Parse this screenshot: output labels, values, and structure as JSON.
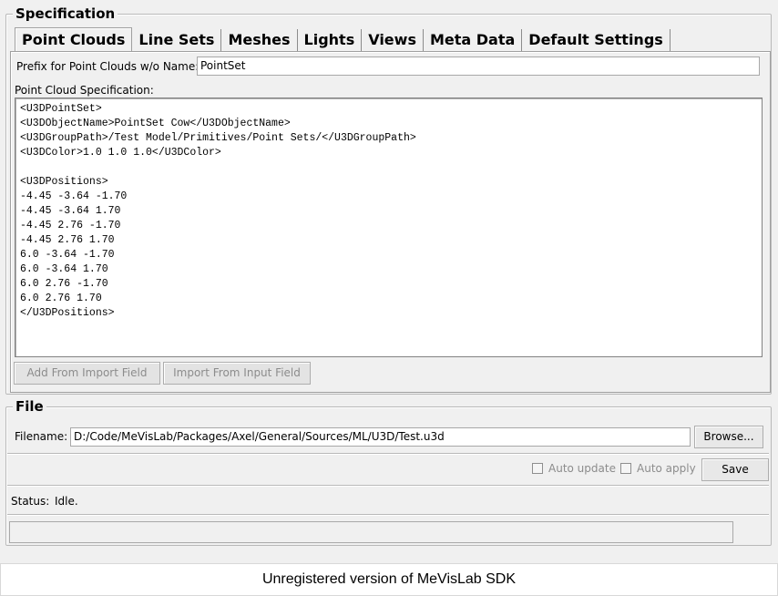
{
  "specification": {
    "title": "Specification",
    "tabs": [
      "Point Clouds",
      "Line Sets",
      "Meshes",
      "Lights",
      "Views",
      "Meta Data",
      "Default Settings"
    ],
    "prefix_label": "Prefix for Point Clouds w/o Name:",
    "prefix_value": "PointSet",
    "spec_label": "Point Cloud Specification:",
    "spec_text": "<U3DPointSet>\n<U3DObjectName>PointSet Cow</U3DObjectName>\n<U3DGroupPath>/Test Model/Primitives/Point Sets/</U3DGroupPath>\n<U3DColor>1.0 1.0 1.0</U3DColor>\n\n<U3DPositions>\n-4.45 -3.64 -1.70\n-4.45 -3.64 1.70\n-4.45 2.76 -1.70\n-4.45 2.76 1.70\n6.0 -3.64 -1.70\n6.0 -3.64 1.70\n6.0 2.76 -1.70\n6.0 2.76 1.70\n</U3DPositions>",
    "add_from_import_label": "Add From Import Field",
    "import_from_input_label": "Import From Input Field"
  },
  "file": {
    "title": "File",
    "filename_label": "Filename:",
    "filename_value": "D:/Code/MeVisLab/Packages/Axel/General/Sources/ML/U3D/Test.u3d",
    "browse_label": "Browse...",
    "auto_update_label": "Auto update",
    "auto_apply_label": "Auto apply",
    "save_label": "Save",
    "status_label": "Status:",
    "status_value": "Idle."
  },
  "footer": {
    "text": "Unregistered version of MeVisLab SDK"
  }
}
